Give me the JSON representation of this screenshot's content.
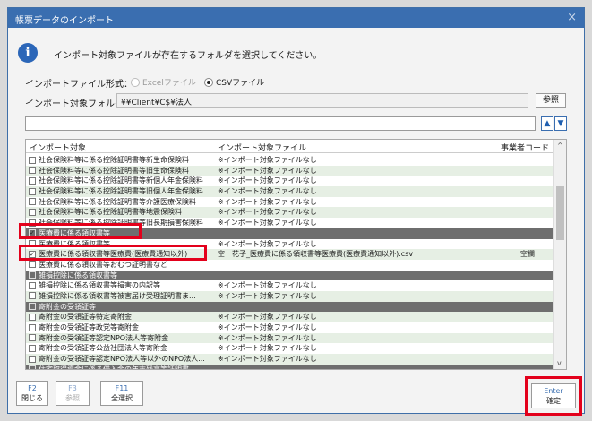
{
  "window": {
    "title": "帳票データのインポート",
    "close_glyph": "×"
  },
  "info": {
    "message": "インポート対象ファイルが存在するフォルダを選択してください。"
  },
  "format": {
    "label": "インポートファイル形式：",
    "options": [
      {
        "label": "Excelファイル",
        "selected": false,
        "disabled": true
      },
      {
        "label": "CSVファイル",
        "selected": true,
        "disabled": false
      }
    ]
  },
  "folder": {
    "label": "インポート対象フォルダ：",
    "value": "¥¥Client¥C$¥法人",
    "browse_label": "参照"
  },
  "nav": {
    "up": "▲",
    "down": "▼"
  },
  "list": {
    "columns": {
      "target": "インポート対象",
      "file": "インポート対象ファイル",
      "code": "事業者コード"
    },
    "rows": [
      {
        "kind": "item",
        "checked": false,
        "name": "社会保険料等に係る控除証明書等新生命保険料",
        "file": "※インポート対象ファイルなし",
        "code": ""
      },
      {
        "kind": "item",
        "checked": false,
        "name": "社会保険料等に係る控除証明書等旧生命保険料",
        "file": "※インポート対象ファイルなし",
        "code": ""
      },
      {
        "kind": "item",
        "checked": false,
        "name": "社会保険料等に係る控除証明書等新個人年金保険料",
        "file": "※インポート対象ファイルなし",
        "code": ""
      },
      {
        "kind": "item",
        "checked": false,
        "name": "社会保険料等に係る控除証明書等旧個人年金保険料",
        "file": "※インポート対象ファイルなし",
        "code": ""
      },
      {
        "kind": "item",
        "checked": false,
        "name": "社会保険料等に係る控除証明書等介護医療保険料",
        "file": "※インポート対象ファイルなし",
        "code": ""
      },
      {
        "kind": "item",
        "checked": false,
        "name": "社会保険料等に係る控除証明書等地震保険料",
        "file": "※インポート対象ファイルなし",
        "code": ""
      },
      {
        "kind": "item",
        "checked": false,
        "name": "社会保険料等に係る控除証明書等旧長期損害保険料",
        "file": "※インポート対象ファイルなし",
        "code": ""
      },
      {
        "kind": "group",
        "checked": true,
        "name": "医療費に係る領収書等",
        "file": "",
        "code": ""
      },
      {
        "kind": "item",
        "checked": false,
        "name": "医療費に係る領収書等",
        "file": "※インポート対象ファイルなし",
        "code": ""
      },
      {
        "kind": "item",
        "checked": true,
        "name": "医療費に係る領収書等医療費(医療費通知以外)",
        "file": "空　花子_医療費に係る領収書等医療費(医療費通知以外).csv",
        "code": "空欄"
      },
      {
        "kind": "item",
        "checked": false,
        "name": "医療費に係る領収書等おむつ証明書など",
        "file": "",
        "code": ""
      },
      {
        "kind": "group",
        "checked": false,
        "name": "雑損控除に係る領収書等",
        "file": "",
        "code": ""
      },
      {
        "kind": "item",
        "checked": false,
        "name": "雑損控除に係る領収書等損害の内訳等",
        "file": "※インポート対象ファイルなし",
        "code": ""
      },
      {
        "kind": "item",
        "checked": false,
        "name": "雑損控除に係る領収書等被害届け受理証明書ま...",
        "file": "※インポート対象ファイルなし",
        "code": ""
      },
      {
        "kind": "group",
        "checked": false,
        "name": "寄附金の受領証等",
        "file": "",
        "code": ""
      },
      {
        "kind": "item",
        "checked": false,
        "name": "寄附金の受領証等特定寄附金",
        "file": "※インポート対象ファイルなし",
        "code": ""
      },
      {
        "kind": "item",
        "checked": false,
        "name": "寄附金の受領証等政党等寄附金",
        "file": "※インポート対象ファイルなし",
        "code": ""
      },
      {
        "kind": "item",
        "checked": false,
        "name": "寄附金の受領証等認定NPO法人等寄附金",
        "file": "※インポート対象ファイルなし",
        "code": ""
      },
      {
        "kind": "item",
        "checked": false,
        "name": "寄附金の受領証等公益社団法人等寄附金",
        "file": "※インポート対象ファイルなし",
        "code": ""
      },
      {
        "kind": "item",
        "checked": false,
        "name": "寄附金の受領証等認定NPO法人等以外のNPO法人...",
        "file": "※インポート対象ファイルなし",
        "code": ""
      },
      {
        "kind": "group",
        "checked": false,
        "name": "住宅取得資金に係る借入金の年末残高等証明書",
        "file": "",
        "code": ""
      }
    ]
  },
  "footer": {
    "keys": [
      {
        "key": "F2",
        "label": "閉じる",
        "disabled": false
      },
      {
        "key": "F3",
        "label": "参照",
        "disabled": true
      },
      {
        "key": "F11",
        "label": "全選択",
        "disabled": false
      }
    ],
    "enter": {
      "key": "Enter",
      "label": "確定"
    }
  }
}
